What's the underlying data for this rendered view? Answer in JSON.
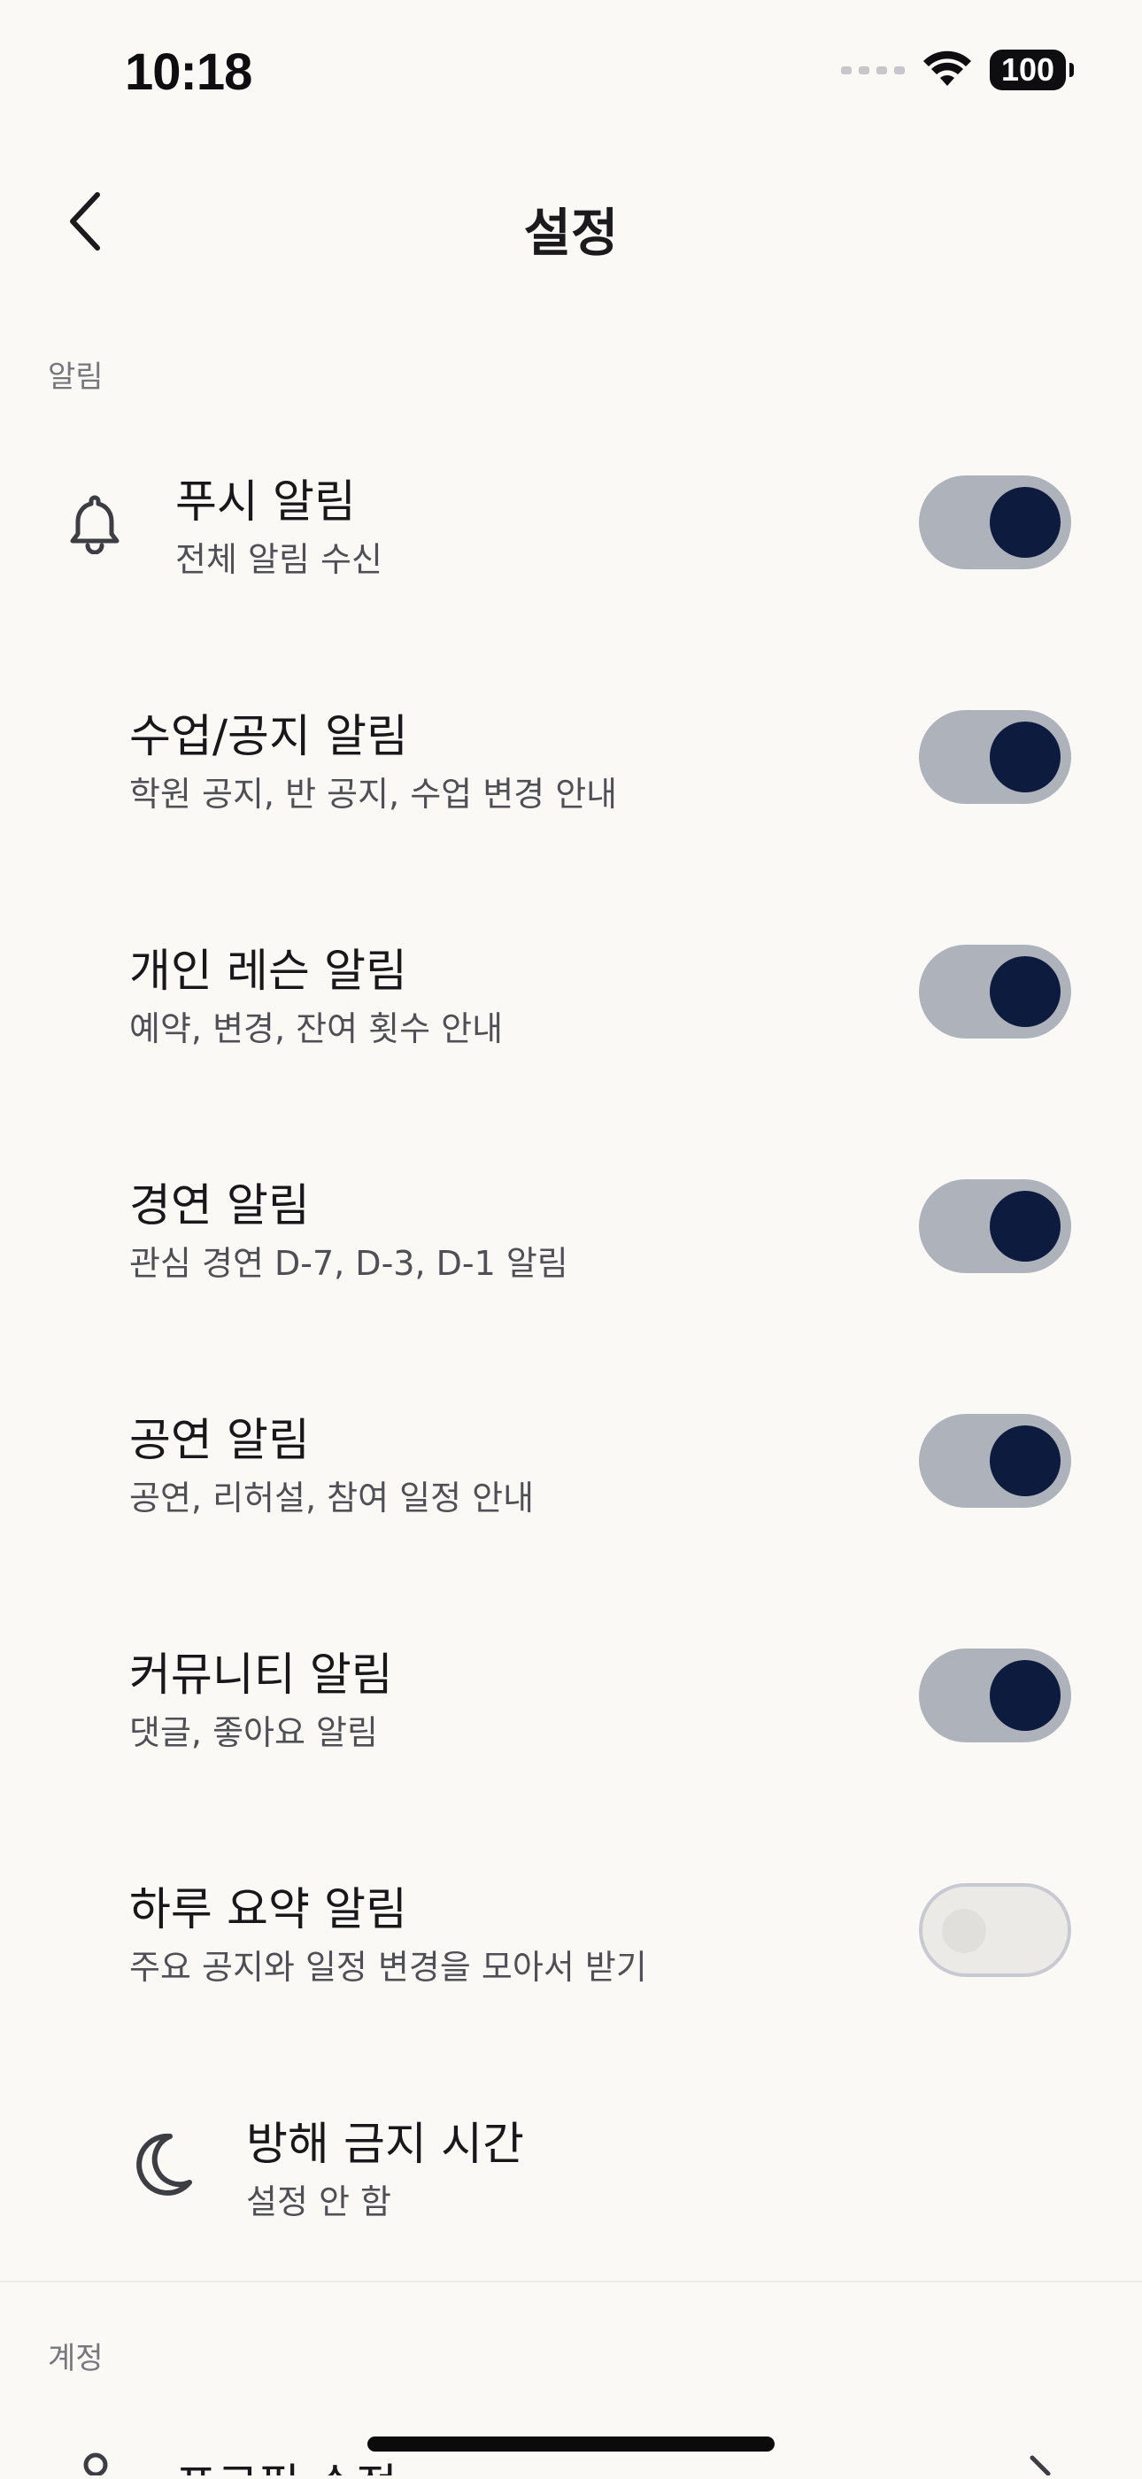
{
  "status_bar": {
    "time": "10:18",
    "battery": "100"
  },
  "header": {
    "title": "설정",
    "back_icon": "chevron-left-icon"
  },
  "sections": {
    "notifications": {
      "label": "알림",
      "push": {
        "title": "푸시 알림",
        "subtitle": "전체 알림 수신",
        "icon": "bell-icon",
        "enabled": true
      },
      "items": [
        {
          "title": "수업/공지 알림",
          "subtitle": "학원 공지, 반 공지, 수업 변경 안내",
          "enabled": true
        },
        {
          "title": "개인 레슨 알림",
          "subtitle": "예약, 변경, 잔여 횟수 안내",
          "enabled": true
        },
        {
          "title": "경연 알림",
          "subtitle": "관심 경연 D-7, D-3, D-1 알림",
          "enabled": true
        },
        {
          "title": "공연 알림",
          "subtitle": "공연, 리허설, 참여 일정 안내",
          "enabled": true
        },
        {
          "title": "커뮤니티 알림",
          "subtitle": "댓글, 좋아요 알림",
          "enabled": true
        },
        {
          "title": "하루 요약 알림",
          "subtitle": "주요 공지와 일정 변경을 모아서 받기",
          "enabled": false
        }
      ],
      "dnd": {
        "title": "방해 금지 시간",
        "subtitle": "설정 안 함",
        "icon": "moon-icon"
      }
    },
    "account": {
      "label": "계정",
      "profile_edit": {
        "title": "프로필 수정",
        "icon": "person-icon"
      }
    }
  },
  "colors": {
    "background": "#faf9f6",
    "toggle_track_on": "#aeb2ba",
    "toggle_knob_on": "#0d1b3e",
    "toggle_track_off": "#ebeae7",
    "muted_text": "#76777c"
  }
}
